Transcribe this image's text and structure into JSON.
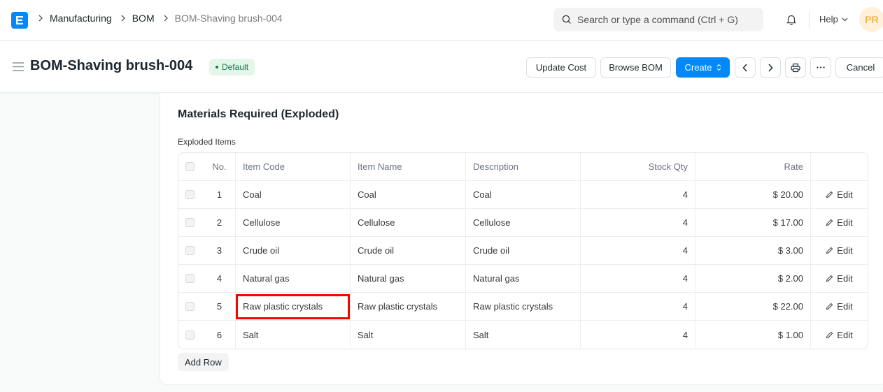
{
  "navbar": {
    "logo": "E",
    "breadcrumbs": [
      "Manufacturing",
      "BOM",
      "BOM-Shaving brush-004"
    ],
    "search_placeholder": "Search or type a command (Ctrl + G)",
    "help_label": "Help",
    "avatar_initials": "PR"
  },
  "page": {
    "title": "BOM-Shaving brush-004",
    "status_badge": "Default",
    "actions": {
      "update_cost": "Update Cost",
      "browse_bom": "Browse BOM",
      "create": "Create",
      "cancel": "Cancel"
    }
  },
  "section": {
    "title": "Materials Required (Exploded)",
    "field_label": "Exploded Items",
    "columns": {
      "no": "No.",
      "item_code": "Item Code",
      "item_name": "Item Name",
      "description": "Description",
      "stock_qty": "Stock Qty",
      "rate": "Rate"
    },
    "rows": [
      {
        "no": "1",
        "item_code": "Coal",
        "item_name": "Coal",
        "description": "Coal",
        "stock_qty": "4",
        "rate": "$ 20.00",
        "edit": "Edit"
      },
      {
        "no": "2",
        "item_code": "Cellulose",
        "item_name": "Cellulose",
        "description": "Cellulose",
        "stock_qty": "4",
        "rate": "$ 17.00",
        "edit": "Edit"
      },
      {
        "no": "3",
        "item_code": "Crude oil",
        "item_name": "Crude oil",
        "description": "Crude oil",
        "stock_qty": "4",
        "rate": "$ 3.00",
        "edit": "Edit"
      },
      {
        "no": "4",
        "item_code": "Natural gas",
        "item_name": "Natural gas",
        "description": "Natural gas",
        "stock_qty": "4",
        "rate": "$ 2.00",
        "edit": "Edit"
      },
      {
        "no": "5",
        "item_code": "Raw plastic crystals",
        "item_name": "Raw plastic crystals",
        "description": "Raw plastic crystals",
        "stock_qty": "4",
        "rate": "$ 22.00",
        "edit": "Edit"
      },
      {
        "no": "6",
        "item_code": "Salt",
        "item_name": "Salt",
        "description": "Salt",
        "stock_qty": "4",
        "rate": "$ 1.00",
        "edit": "Edit"
      }
    ],
    "add_row_label": "Add Row"
  },
  "colors": {
    "primary": "#0289f7",
    "badge_bg": "#e4f5e9",
    "badge_text": "#16794c",
    "highlight": "#ff0000"
  }
}
